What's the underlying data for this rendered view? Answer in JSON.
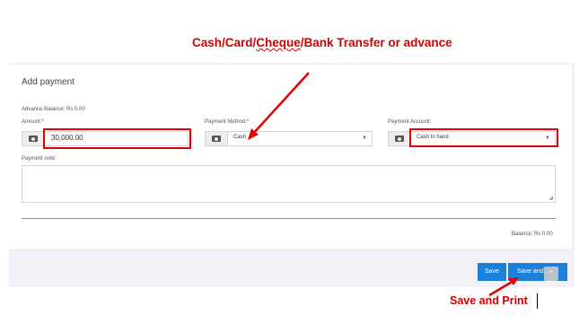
{
  "form": {
    "title": "Add payment",
    "advance_balance": "Advance Balance: Rs 0.00",
    "amount_label": "Amount:*",
    "amount_value": "30,000.00",
    "method_label": "Payment Method:*",
    "method_value": "Cash",
    "account_label": "Payment Account:",
    "account_value": "Cash In hand",
    "note_label": "Payment note:",
    "balance": "Balance: Rs 0.00"
  },
  "buttons": {
    "save": "Save",
    "save_and_print": "Save and Print"
  },
  "annotations": {
    "top_prefix": "Cash/Card/",
    "top_underlined": "Cheque",
    "top_suffix": "/Bank Transfer or advance",
    "bottom": "Save and Print"
  },
  "icons": {
    "money": "money-icon",
    "caret": "caret-down-icon",
    "scroll_top": "chevron-up-icon"
  },
  "colors": {
    "annotation_red": "#e20000",
    "button_blue": "#1a80d9"
  }
}
